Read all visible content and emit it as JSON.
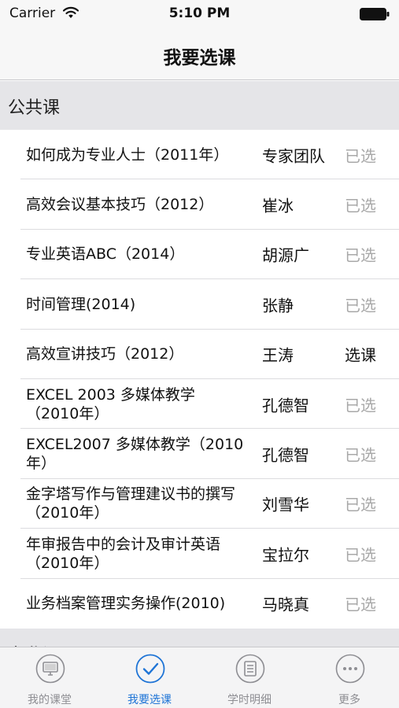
{
  "status_bar": {
    "carrier": "Carrier",
    "time": "5:10 PM"
  },
  "nav": {
    "title": "我要选课"
  },
  "sections": [
    {
      "title": "公共课",
      "rows": [
        {
          "course": "如何成为专业人士（2011年）",
          "teacher": "专家团队",
          "action": "已选",
          "enabled": false
        },
        {
          "course": "高效会议基本技巧（2012）",
          "teacher": "崔冰",
          "action": "已选",
          "enabled": false
        },
        {
          "course": "专业英语ABC（2014）",
          "teacher": "胡源广",
          "action": "已选",
          "enabled": false
        },
        {
          "course": "时间管理(2014)",
          "teacher": "张静",
          "action": "已选",
          "enabled": false
        },
        {
          "course": "高效宣讲技巧（2012）",
          "teacher": "王涛",
          "action": "选课",
          "enabled": true
        },
        {
          "course": "EXCEL 2003 多媒体教学（2010年）",
          "teacher": "孔德智",
          "action": "已选",
          "enabled": false
        },
        {
          "course": "EXCEL2007 多媒体教学（2010年）",
          "teacher": "孔德智",
          "action": "已选",
          "enabled": false
        },
        {
          "course": "金字塔写作与管理建议书的撰写 （2010年）",
          "teacher": "刘雪华",
          "action": "已选",
          "enabled": false
        },
        {
          "course": "年审报告中的会计及审计英语 （2010年）",
          "teacher": "宝拉尔",
          "action": "已选",
          "enabled": false
        },
        {
          "course": "业务档案管理实务操作(2010)",
          "teacher": "马晓真",
          "action": "已选",
          "enabled": false
        }
      ]
    },
    {
      "title": "专业课",
      "rows": []
    }
  ],
  "tabs": [
    {
      "label": "我的课堂",
      "icon": "monitor-icon",
      "active": false
    },
    {
      "label": "我要选课",
      "icon": "checkmark-icon",
      "active": true
    },
    {
      "label": "学时明细",
      "icon": "list-icon",
      "active": false
    },
    {
      "label": "更多",
      "icon": "more-icon",
      "active": false
    }
  ],
  "colors": {
    "accent": "#1e74d6",
    "inactive": "#8e8e93",
    "selected_text": "#a8a8a8"
  }
}
